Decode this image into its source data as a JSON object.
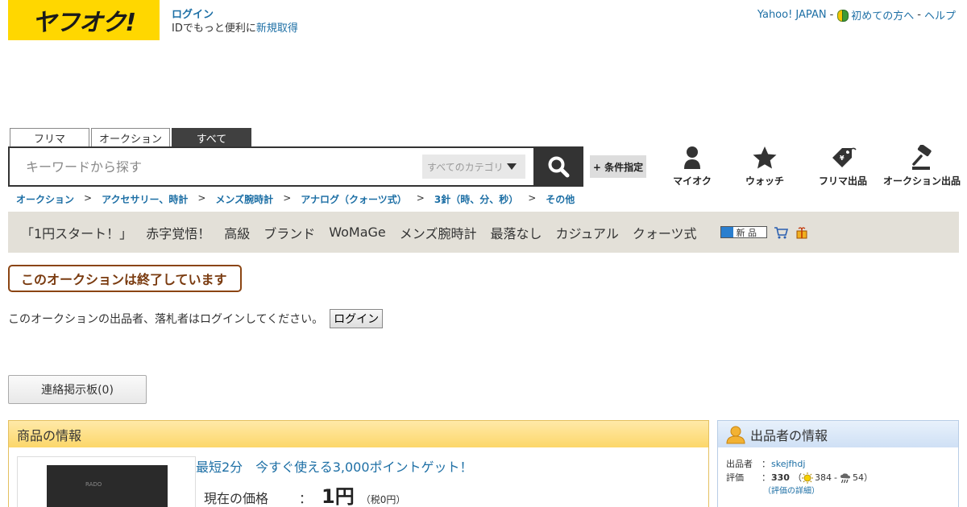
{
  "header": {
    "logo_text": "ヤフオク!",
    "login_label": "ログイン",
    "login_note_prefix": "IDでもっと便利に",
    "signup_label": "新規取得",
    "top_links": {
      "yahoo_japan": "Yahoo! JAPAN",
      "sep1": "-",
      "beginners": "初めての方へ",
      "sep2": "-",
      "help": "ヘルプ"
    }
  },
  "search": {
    "tabs": [
      {
        "label": "フリマ",
        "active": false
      },
      {
        "label": "オークション",
        "active": false
      },
      {
        "label": "すべて",
        "active": true
      }
    ],
    "placeholder": "キーワードから探す",
    "category_label": "すべてのカテゴリ",
    "condition_button": "+ 条件指定"
  },
  "nav_icons": [
    {
      "label": "マイオク",
      "icon": "person-icon"
    },
    {
      "label": "ウォッチ",
      "icon": "star-icon"
    },
    {
      "label": "フリマ出品",
      "icon": "tag-icon"
    },
    {
      "label": "オークション出品",
      "icon": "gavel-icon"
    }
  ],
  "breadcrumb": {
    "sep": ">",
    "items": [
      "オークション",
      "アクセサリー、時計",
      "メンズ腕時計",
      "アナログ（クォーツ式）",
      "3針（時、分、秒）",
      "その他"
    ]
  },
  "tags": [
    "「1円スタート！」",
    "赤字覚悟！",
    "高級",
    "ブランド",
    "WoMaGe",
    "メンズ腕時計",
    "最落なし",
    "カジュアル",
    "クォーツ式"
  ],
  "badge_new_label": "新 品",
  "ended_message": "このオークションは終了しています",
  "login_note": "このオークションの出品者、落札者はログインしてください。",
  "login_button": "ログイン",
  "board_button": "連絡掲示板(0)",
  "item_panel": {
    "title": "商品の情報",
    "promo": "最短2分　今すぐ使える3,000ポイントゲット！",
    "price_label": "現在の価格",
    "price_colon": "：",
    "price_value": "1円",
    "price_tax": "（税0円）"
  },
  "seller_panel": {
    "title": "出品者の情報",
    "seller_label": "出品者",
    "colon": "：",
    "seller_id": "skejfhdj",
    "rating_label": "評価",
    "rating_total": "330",
    "rating_open": "（",
    "rating_good": "384",
    "rating_dash": "-",
    "rating_bad": "54",
    "rating_close": "）",
    "rating_detail": "（評価の詳細）"
  },
  "colors": {
    "logo_bg": "#ffd700",
    "link": "#1d6fa5",
    "tag_bar_bg": "#e3e0d8",
    "ended_border": "#8b4513"
  }
}
